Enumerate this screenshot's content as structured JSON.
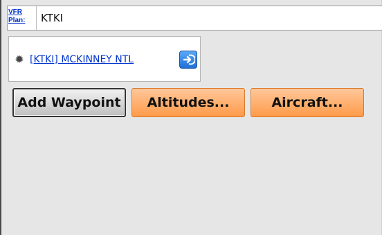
{
  "header": {
    "vfr_line1": "VFR",
    "vfr_line2": "Plan:",
    "plan_value": "KTKI"
  },
  "waypoint": {
    "gear_icon": "gear-icon",
    "label": "[KTKI] MCKINNEY NTL",
    "action_icon": "direct-to-icon"
  },
  "buttons": {
    "add_waypoint": "Add Waypoint",
    "altitudes": "Altitudes...",
    "aircraft": "Aircraft..."
  },
  "colors": {
    "background": "#e6e6e6",
    "link": "#0033cc",
    "orange_button": "#ffb071",
    "gray_button": "#d9d9d9"
  }
}
